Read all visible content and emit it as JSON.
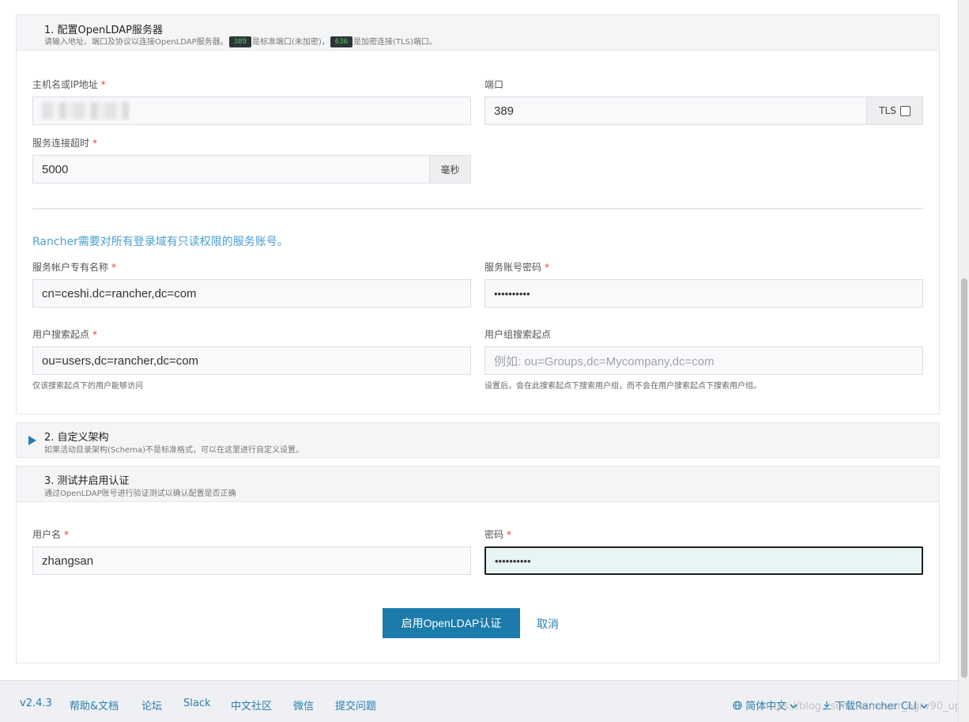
{
  "section1": {
    "title": "1. 配置OpenLDAP服务器",
    "desc_a": "请输入地址、端口及协议以连接OpenLDAP服务器。",
    "code_a": "389",
    "desc_b": "是标准端口(未加密)，",
    "code_b": "636",
    "desc_c": "是加密连接(TLS)端口。",
    "host": {
      "label": "主机名或IP地址",
      "required": "*"
    },
    "port": {
      "label": "端口",
      "value": "389",
      "tls_label": "TLS",
      "tls_checked": false
    },
    "timeout": {
      "label": "服务连接超时",
      "required": "*",
      "value": "5000",
      "unit": "毫秒"
    },
    "service_note": "Rancher需要对所有登录域有只读权限的服务账号。",
    "bind_dn": {
      "label": "服务帐户专有名称",
      "required": "*",
      "value": "cn=ceshi.dc=rancher,dc=com"
    },
    "bind_password": {
      "label": "服务账号密码",
      "required": "*",
      "value": "••••••••••"
    },
    "user_base": {
      "label": "用户搜索起点",
      "required": "*",
      "value": "ou=users,dc=rancher,dc=com",
      "help": "仅该搜索起点下的用户能够访问"
    },
    "group_base": {
      "label": "用户组搜索起点",
      "placeholder": "例如: ou=Groups,dc=Mycompany,dc=com",
      "help": "设置后，会在此搜索起点下搜索用户组，而不会在用户搜索起点下搜索用户组。"
    }
  },
  "section2": {
    "toggle_icon": "triangle-right-icon",
    "title": "2. 自定义架构",
    "desc": "如果活动目录架构(Schema)不是标准格式，可以在这里进行自定义设置。"
  },
  "section3": {
    "title": "3. 测试并启用认证",
    "desc": "通过OpenLDAP账号进行验证测试以确认配置是否正确",
    "username": {
      "label": "用户名",
      "required": "*",
      "value": "zhangsan"
    },
    "password": {
      "label": "密码",
      "required": "*",
      "value": "••••••••••"
    },
    "enable_button": "启用OpenLDAP认证",
    "cancel_button": "取消"
  },
  "footer": {
    "version": "v2.4.3",
    "help": "帮助&文档",
    "forum": "论坛",
    "slack": "Slack",
    "community": "中文社区",
    "wechat": "微信",
    "issue": "提交问题",
    "language": "简体中文",
    "download": "下载Rancher CLI"
  },
  "watermark": "https://blog.csdn.net/never_ogrv90_up",
  "colors": {
    "primary": "#1d7bab",
    "link": "#2b7db0",
    "note": "#4a9fd0",
    "required": "#e04545",
    "code_bg": "#2d3539",
    "code_fg": "#58c262"
  }
}
